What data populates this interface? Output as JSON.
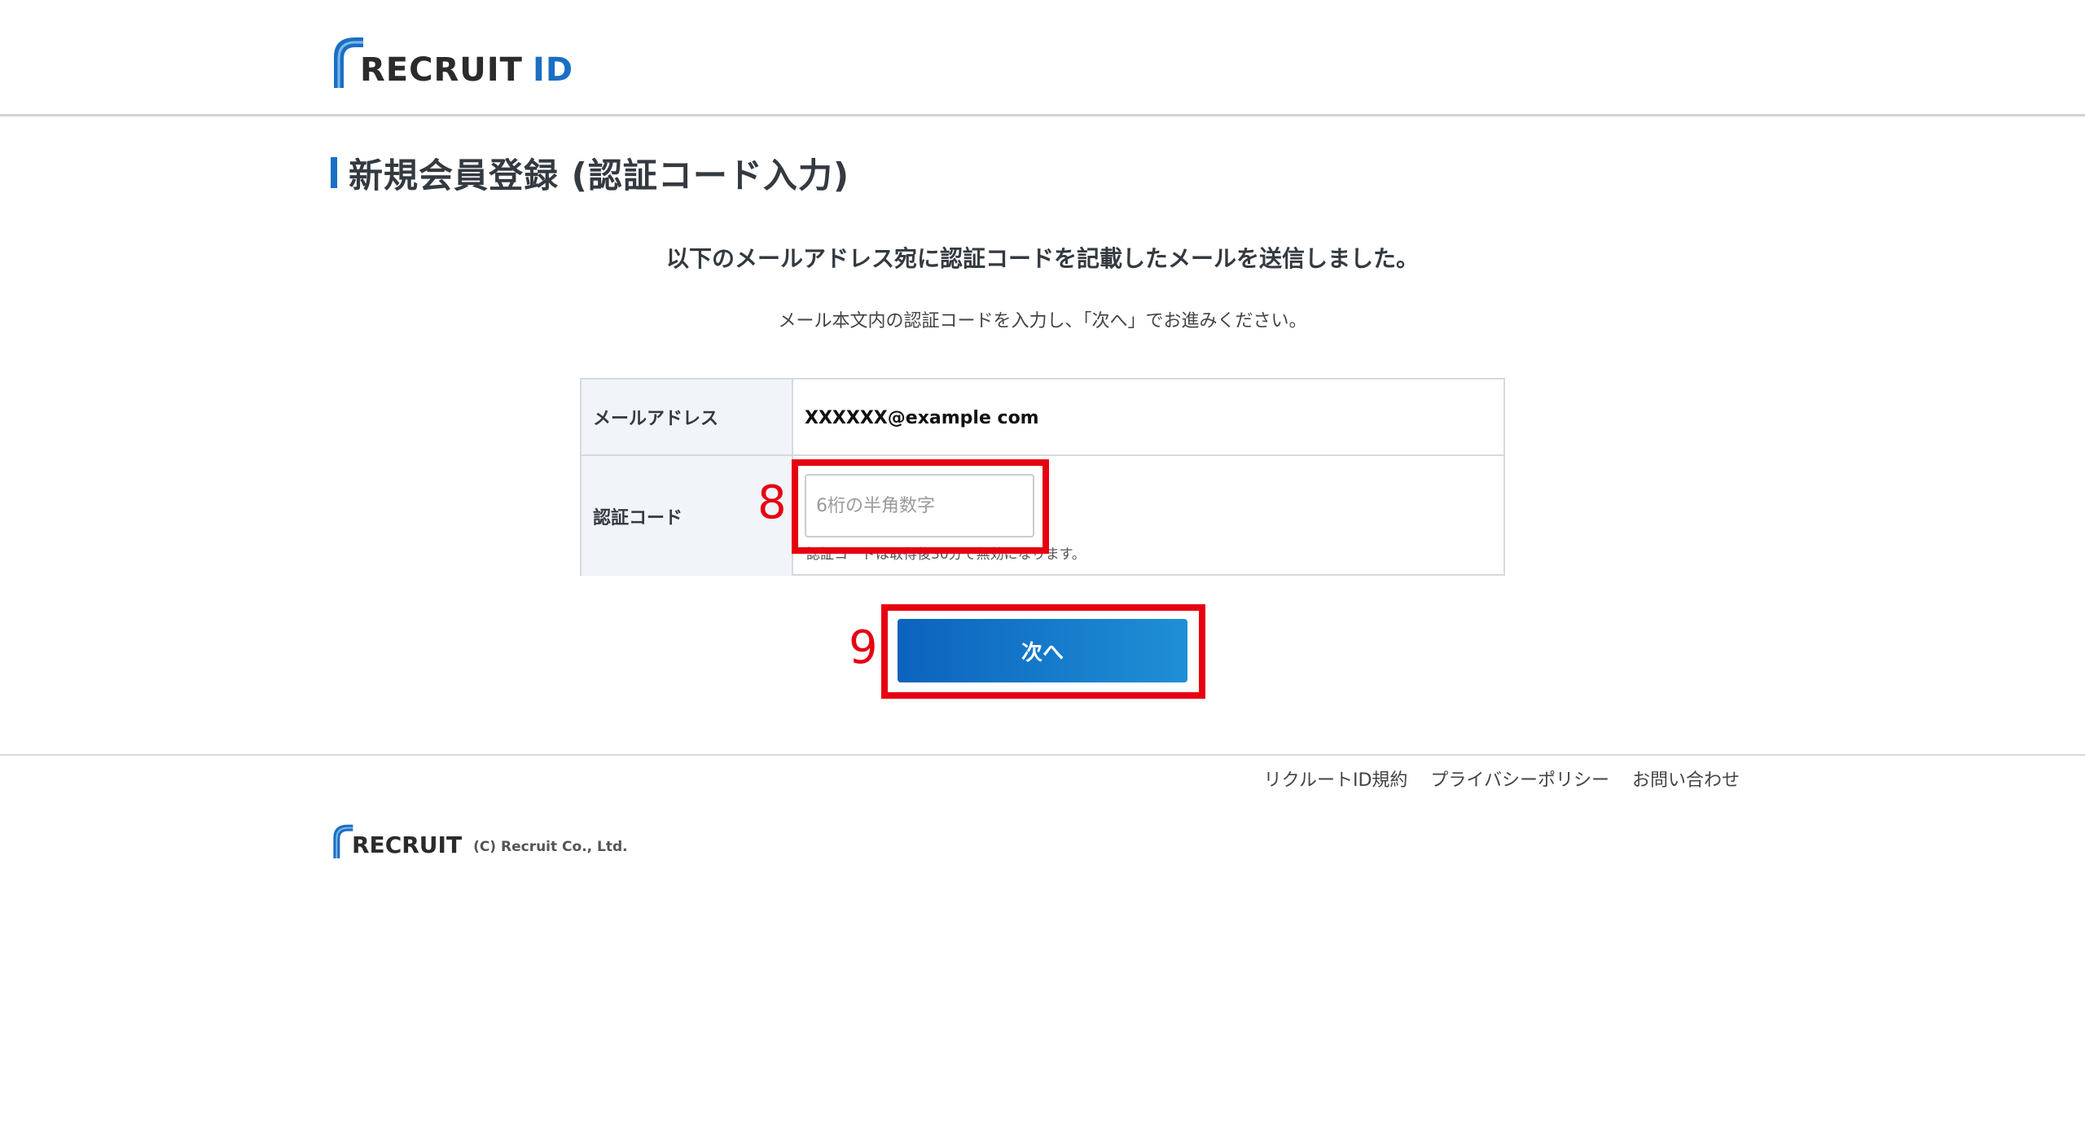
{
  "header": {
    "logo_text": "RECRUIT",
    "logo_id": "ID"
  },
  "main": {
    "page_title": "新規会員登録 (認証コード入力)",
    "lead": "以下のメールアドレス宛に認証コードを記載したメールを送信しました。",
    "sub": "メール本文内の認証コードを入力し、「次へ」でお進みください。",
    "form": {
      "email_label": "メールアドレス",
      "email_value": "XXXXXX@example com",
      "code_label": "認証コード",
      "code_placeholder": "6桁の半角数字",
      "code_note": "認証コードは取得後30分で無効になります。"
    },
    "next_label": "次へ"
  },
  "annotations": {
    "marker_8": "8",
    "marker_9": "9"
  },
  "footer": {
    "links": [
      "リクルートID規約",
      "プライバシーポリシー",
      "お問い合わせ"
    ],
    "logo_text": "RECRUIT",
    "copyright": "(C) Recruit Co., Ltd."
  },
  "colors": {
    "brand_blue": "#1a6fc4",
    "annotation_red": "#e60012"
  }
}
